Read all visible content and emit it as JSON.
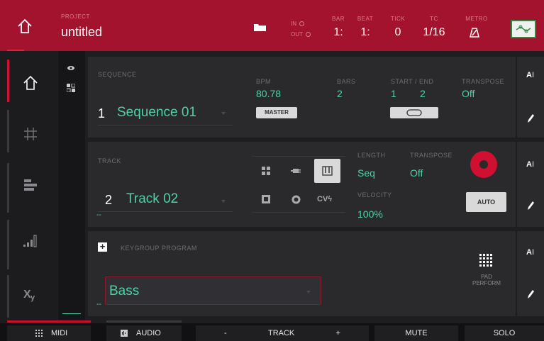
{
  "header": {
    "project_label": "PROJECT",
    "project_name": "untitled",
    "in_label": "IN",
    "out_label": "OUT",
    "bar_label": "BAR",
    "bar_value": "1:",
    "beat_label": "BEAT",
    "beat_value": "1:",
    "tick_label": "TICK",
    "tick_value": "0",
    "tc_label": "TC",
    "tc_value": "1/16",
    "metro_label": "METRO"
  },
  "sequence": {
    "label": "SEQUENCE",
    "number": "1",
    "name": "Sequence 01",
    "bpm_label": "BPM",
    "bpm_value": "80.78",
    "master_label": "MASTER",
    "bars_label": "BARS",
    "bars_value": "2",
    "start_end_label": "START / END",
    "start_value": "1",
    "end_value": "2",
    "transpose_label": "TRANSPOSE",
    "transpose_value": "Off"
  },
  "track": {
    "label": "TRACK",
    "number": "2",
    "name": "Track 02",
    "cv_label": "CV",
    "length_label": "LENGTH",
    "length_value": "Seq",
    "transpose_label": "TRANSPOSE",
    "transpose_value": "Off",
    "velocity_label": "VELOCITY",
    "velocity_value": "100%",
    "auto_label": "AUTO"
  },
  "program": {
    "label": "KEYGROUP PROGRAM",
    "name": "Bass",
    "pad_perform_line1": "PAD",
    "pad_perform_line2": "PERFORM"
  },
  "bottom_bar": {
    "midi": "MIDI",
    "audio": "AUDIO",
    "minus": "-",
    "track": "TRACK",
    "plus": "+",
    "mute": "MUTE",
    "solo": "SOLO"
  },
  "colors": {
    "header_red": "#a3132e",
    "accent_green": "#4fd1a5",
    "record_red": "#d01030"
  }
}
